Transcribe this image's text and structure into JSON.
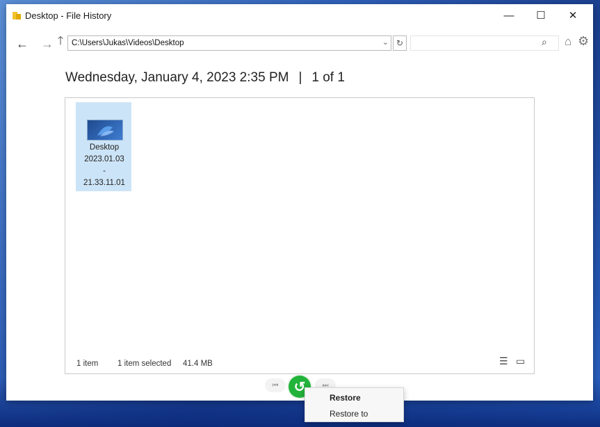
{
  "window": {
    "title": "Desktop - File History",
    "minimize_label": "—",
    "maximize_label": "☐",
    "close_label": "✕"
  },
  "nav": {
    "back_glyph": "←",
    "forward_glyph": "→",
    "up_glyph": "🡑",
    "address": "C:\\Users\\Jukas\\Videos\\Desktop",
    "address_dropdown_glyph": "⌄",
    "refresh_glyph": "↻",
    "search_placeholder": "",
    "search_glyph": "⌕",
    "home_glyph": "⌂",
    "settings_glyph": "⚙"
  },
  "heading": {
    "date": "Wednesday, January 4, 2023 2:35 PM",
    "separator": "|",
    "position": "1 of 1"
  },
  "items": [
    {
      "name_lines": [
        "Desktop",
        "2023.01.03",
        "-",
        "21.33.11.01"
      ],
      "selected": true,
      "icon": "folder-thumbnail-icon"
    }
  ],
  "status": {
    "count": "1 item",
    "selected": "1 item selected",
    "size": "41.4 MB"
  },
  "view_icons": {
    "details": "☰",
    "tiles": "▭"
  },
  "controls": {
    "previous_glyph": "⏮",
    "restore_glyph": "↺",
    "next_glyph": "⏭"
  },
  "context_menu": {
    "items": [
      "Restore",
      "Restore to"
    ]
  },
  "colors": {
    "restore_button": "#22b33a",
    "selection": "#cce4f7"
  }
}
